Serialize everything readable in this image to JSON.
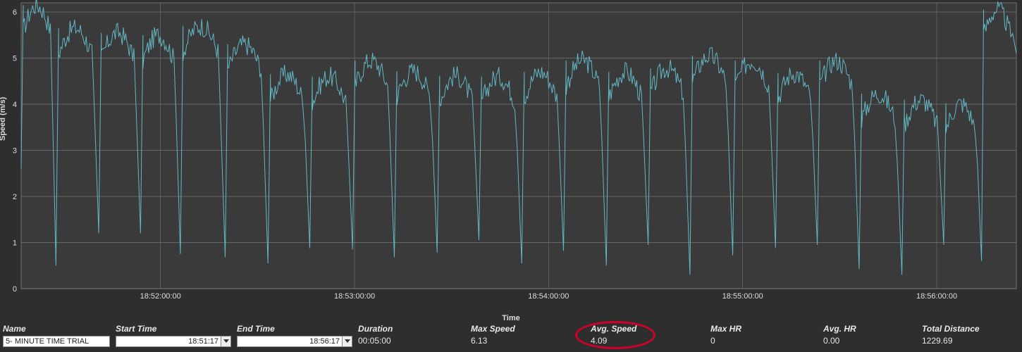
{
  "chart_data": {
    "type": "line",
    "title": "",
    "xlabel": "Time",
    "ylabel": "Speed (m/s)",
    "ylim": [
      0,
      6.2
    ],
    "x_ticks": [
      "18:52:00:00",
      "18:53:00:00",
      "18:54:00:00",
      "18:55:00:00",
      "18:56:00:00"
    ],
    "y_ticks": [
      0,
      1,
      2,
      3,
      4,
      5,
      6
    ],
    "series": [
      {
        "name": "Speed",
        "color": "#63b7c5",
        "oscillations": [
          {
            "t0": 0.0,
            "t1": 0.035,
            "peak": 6.15,
            "dip": 0.5
          },
          {
            "t0": 0.035,
            "t1": 0.078,
            "peak": 5.65,
            "dip": 1.2
          },
          {
            "t0": 0.078,
            "t1": 0.12,
            "peak": 5.55,
            "dip": 1.2
          },
          {
            "t0": 0.12,
            "t1": 0.16,
            "peak": 5.5,
            "dip": 0.75
          },
          {
            "t0": 0.16,
            "t1": 0.205,
            "peak": 5.7,
            "dip": 0.68
          },
          {
            "t0": 0.205,
            "t1": 0.248,
            "peak": 5.3,
            "dip": 0.55
          },
          {
            "t0": 0.248,
            "t1": 0.29,
            "peak": 4.65,
            "dip": 0.88
          },
          {
            "t0": 0.29,
            "t1": 0.333,
            "peak": 4.6,
            "dip": 0.85
          },
          {
            "t0": 0.333,
            "t1": 0.375,
            "peak": 4.95,
            "dip": 0.68
          },
          {
            "t0": 0.375,
            "t1": 0.418,
            "peak": 4.72,
            "dip": 0.78
          },
          {
            "t0": 0.418,
            "t1": 0.46,
            "peak": 4.62,
            "dip": 1.05
          },
          {
            "t0": 0.46,
            "t1": 0.503,
            "peak": 4.6,
            "dip": 0.55
          },
          {
            "t0": 0.503,
            "t1": 0.545,
            "peak": 4.7,
            "dip": 0.82
          },
          {
            "t0": 0.545,
            "t1": 0.588,
            "peak": 4.95,
            "dip": 0.5
          },
          {
            "t0": 0.588,
            "t1": 0.63,
            "peak": 4.7,
            "dip": 0.95
          },
          {
            "t0": 0.63,
            "t1": 0.672,
            "peak": 4.78,
            "dip": 0.3
          },
          {
            "t0": 0.672,
            "t1": 0.715,
            "peak": 5.05,
            "dip": 0.72
          },
          {
            "t0": 0.715,
            "t1": 0.758,
            "peak": 4.95,
            "dip": 0.88
          },
          {
            "t0": 0.758,
            "t1": 0.8,
            "peak": 4.68,
            "dip": 0.95
          },
          {
            "t0": 0.8,
            "t1": 0.842,
            "peak": 4.95,
            "dip": 0.42
          },
          {
            "t0": 0.842,
            "t1": 0.885,
            "peak": 4.23,
            "dip": 0.3
          },
          {
            "t0": 0.885,
            "t1": 0.927,
            "peak": 4.1,
            "dip": 0.95
          },
          {
            "t0": 0.927,
            "t1": 0.965,
            "peak": 4.02,
            "dip": 0.6
          },
          {
            "t0": 0.965,
            "t1": 1.0,
            "peak": 6.05,
            "dip": 5.1
          }
        ]
      }
    ]
  },
  "fields": {
    "name": {
      "label": "Name",
      "value": "5- MINUTE TIME TRIAL"
    },
    "start": {
      "label": "Start Time",
      "value": "18:51:17"
    },
    "end": {
      "label": "End Time",
      "value": "18:56:17"
    },
    "duration": {
      "label": "Duration",
      "value": "00:05:00"
    },
    "max_speed": {
      "label": "Max Speed",
      "value": "6.13"
    },
    "avg_speed": {
      "label": "Avg. Speed",
      "value": "4.09"
    },
    "max_hr": {
      "label": "Max HR",
      "value": "0"
    },
    "avg_hr": {
      "label": "Avg. HR",
      "value": "0.00"
    },
    "total_distance": {
      "label": "Total Distance",
      "value": "1229.69"
    }
  }
}
